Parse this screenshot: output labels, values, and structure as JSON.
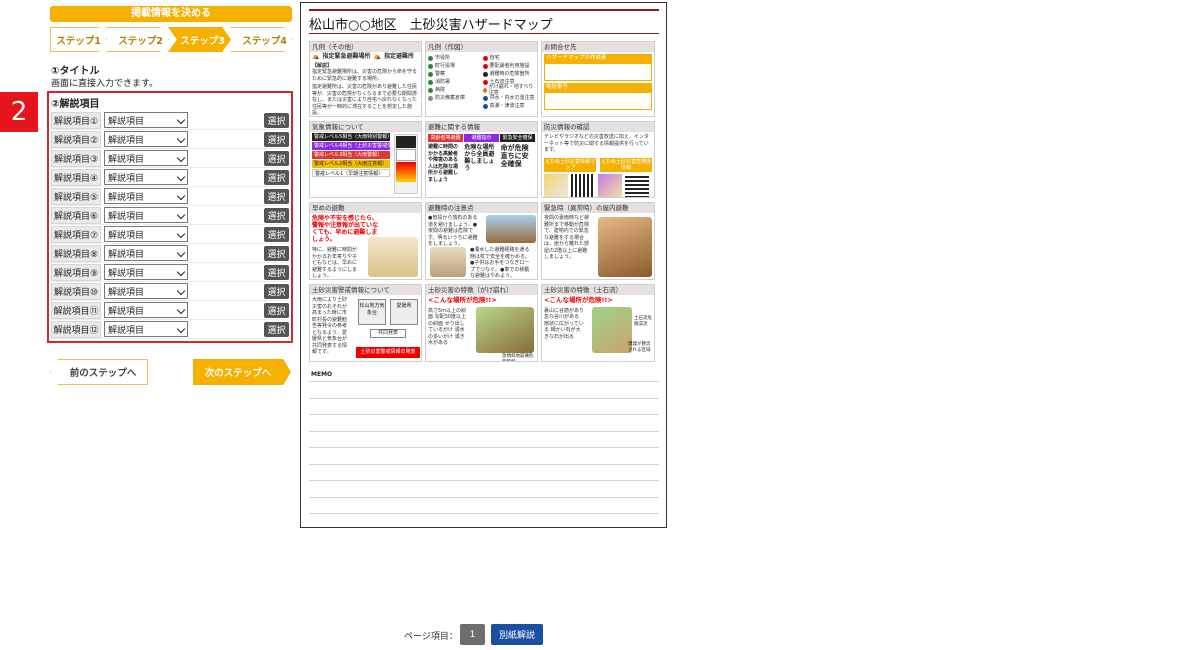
{
  "header": {
    "banner": "掲載情報を決める"
  },
  "steps": [
    "ステップ1",
    "ステップ2",
    "ステップ3",
    "ステップ4"
  ],
  "active_step": 2,
  "section1": {
    "title": "①タイトル",
    "note": "画面に直接入力できます。"
  },
  "section2": {
    "badge": "2",
    "title": "②解説項目",
    "select_value": "解説項目",
    "button": "選択",
    "items": [
      "解説項目①",
      "解説項目②",
      "解説項目③",
      "解説項目④",
      "解説項目⑤",
      "解説項目⑥",
      "解説項目⑦",
      "解説項目⑧",
      "解説項目⑨",
      "解説項目⑩",
      "解説項目⑪",
      "解説項目⑫"
    ]
  },
  "nav": {
    "prev": "前のステップへ",
    "next": "次のステップへ"
  },
  "preview": {
    "title": "松山市○○地区　土砂災害ハザードマップ",
    "legend_other": {
      "heading": "凡例（その他）",
      "item1": "指定緊急避難場所",
      "item2": "指定避難所",
      "note_label": "【解説】",
      "text1": "指定緊急避難場所は、災害の危険から命を守るために緊急的に避難する場所。",
      "text2": "指定避難所は、災害の危険があり避難した住民等が、災害の危険がなくなるまで必要な期間滞在し、または災害により自宅へ戻れなくなった住民等が一時的に滞在することを想定した施設。"
    },
    "legend_made": {
      "heading": "凡例（作図）",
      "items": [
        "市役所",
        "自宅",
        "町行役場",
        "要配慮者利用施設",
        "警察",
        "避難時の危険箇所",
        "消防署",
        "土石流注意",
        "病院",
        "がけ崩れ・地すべり注意",
        "防災備蓄倉庫",
        "洪水・内水氾濫注意",
        "",
        "高潮・津波注意"
      ]
    },
    "contact": {
      "heading": "お問合せ先",
      "label1": "ハザードマップの作成者",
      "label2": "電話番号"
    },
    "weather": {
      "heading": "気象情報について",
      "levels": [
        "警戒レベル5相当（大雨特別警報）",
        "警戒レベル4相当（土砂災害警戒情報）",
        "警戒レベル3相当（大雨警報）",
        "警戒レベル2相当（大雨注意報）",
        "警戒レベル1（早期注意情報）"
      ]
    },
    "evac_info": {
      "heading": "避難に関する情報",
      "tabs": [
        "高齢者等避難",
        "避難指示",
        "緊急安全確保"
      ],
      "box1": "避難に時間のかかる高齢者や障害のある人は危険な場所から避難しましょう",
      "box2": "危険な場所から全員避難しましょう",
      "box3": "命が危険直ちに安全確保"
    },
    "disaster_info": {
      "heading": "防災情報の確認",
      "text": "テレビやラジオなどの災害放送に加え、インターネット等で防災に関する情報提供を行っています。",
      "btn1": "えひめ土砂災害情報マップ",
      "btn2": "えひめ土砂災害危険度情報"
    },
    "early": {
      "heading": "早めの避難",
      "text": "危険や不安を感じたら、警報や注意報が出ていなくても、早めに避難しましょう。",
      "note": "特に、避難に時間がかかるお年寄りや子どもなどは、早めに避難するようにしましょう。"
    },
    "caution": {
      "heading": "避難時の注意点",
      "text": "●普段から落石のある道を避けましょう。●夜間の避難は危険です。明るいうちに避難をしましょう。",
      "note": "●濁水した避難経路を通る時は杖で安全を確かめる。●子供はお手をつなぎロープでつなぐ。●車での移動な避難はやめよう。"
    },
    "emergency": {
      "heading": "緊急時（異常時）の屋内避難",
      "text": "夜間の豪雨時など避難所まで移動が危険で、建物内での緊急な避難をする場合は、崖から離れた部屋の2階以上に避難しましょう。"
    },
    "warning": {
      "heading": "土砂災害警戒情報について",
      "text": "大雨により土砂災害のおそれが高まった時に市町村長の避難勧告等発令の参考となるよう、愛媛県と気象台が共同発表する情報です。",
      "box1": "松山地方気象台",
      "box2": "愛媛県",
      "box3": "共同発表",
      "box4": "土砂災害警戒情報の発表"
    },
    "feature1": {
      "heading": "土砂災害の特徴（がけ崩れ）",
      "title": "<こんな場所が危険!!>",
      "text": "高さ5m以上の斜面 勾配30度以上の斜面 せり出しているがけ 湧水の多いがけ 湧き水がある",
      "label": "急傾斜地崩壊危険箇所"
    },
    "feature2": {
      "heading": "土砂災害の特徴（土石流）",
      "title": "<こんな場所が危険!!>",
      "text": "裏山に谷筋があり急な谷川がある 扇状に広がっている 細かい石が大きな石が出る",
      "label1": "土石流危険渓流",
      "label2": "爆発が懸念される区域"
    },
    "memo": "MEMO"
  },
  "footer": {
    "page_label": "ページ項目：",
    "page_num": "1",
    "separate_btn": "別紙解説"
  }
}
